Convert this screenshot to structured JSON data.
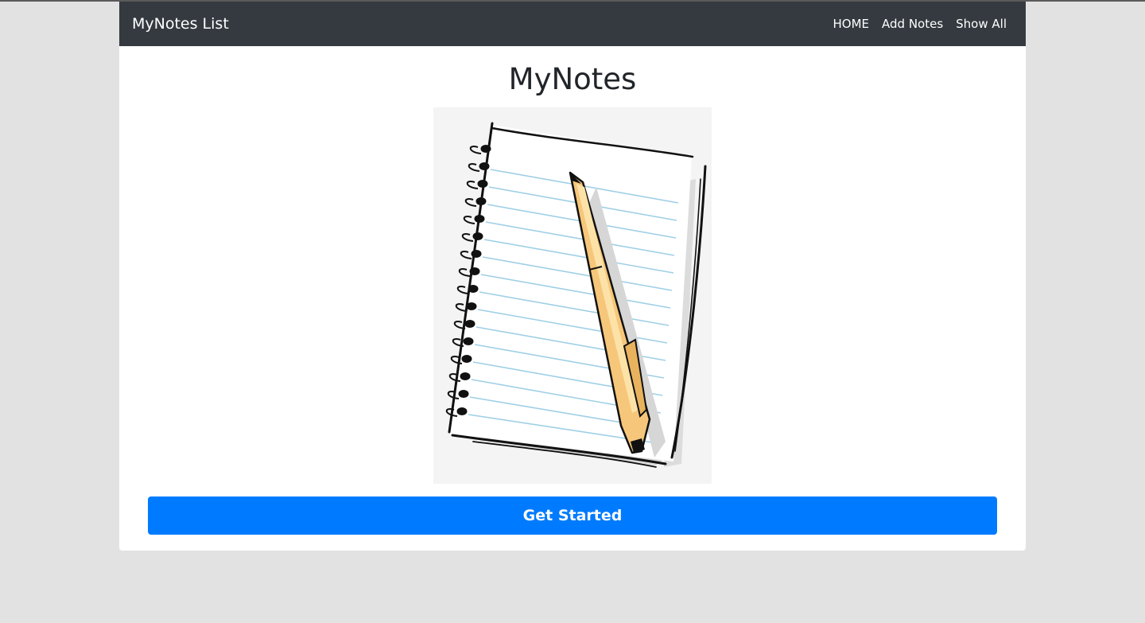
{
  "navbar": {
    "brand": "MyNotes List",
    "links": [
      "HOME",
      "Add Notes",
      "Show All"
    ]
  },
  "main": {
    "title": "MyNotes",
    "image": "notebook-and-pen-illustration",
    "cta_label": "Get Started"
  },
  "colors": {
    "navbar_bg": "#343a40",
    "page_bg": "#e2e2e2",
    "button_bg": "#007bff",
    "title_text": "#212529"
  }
}
